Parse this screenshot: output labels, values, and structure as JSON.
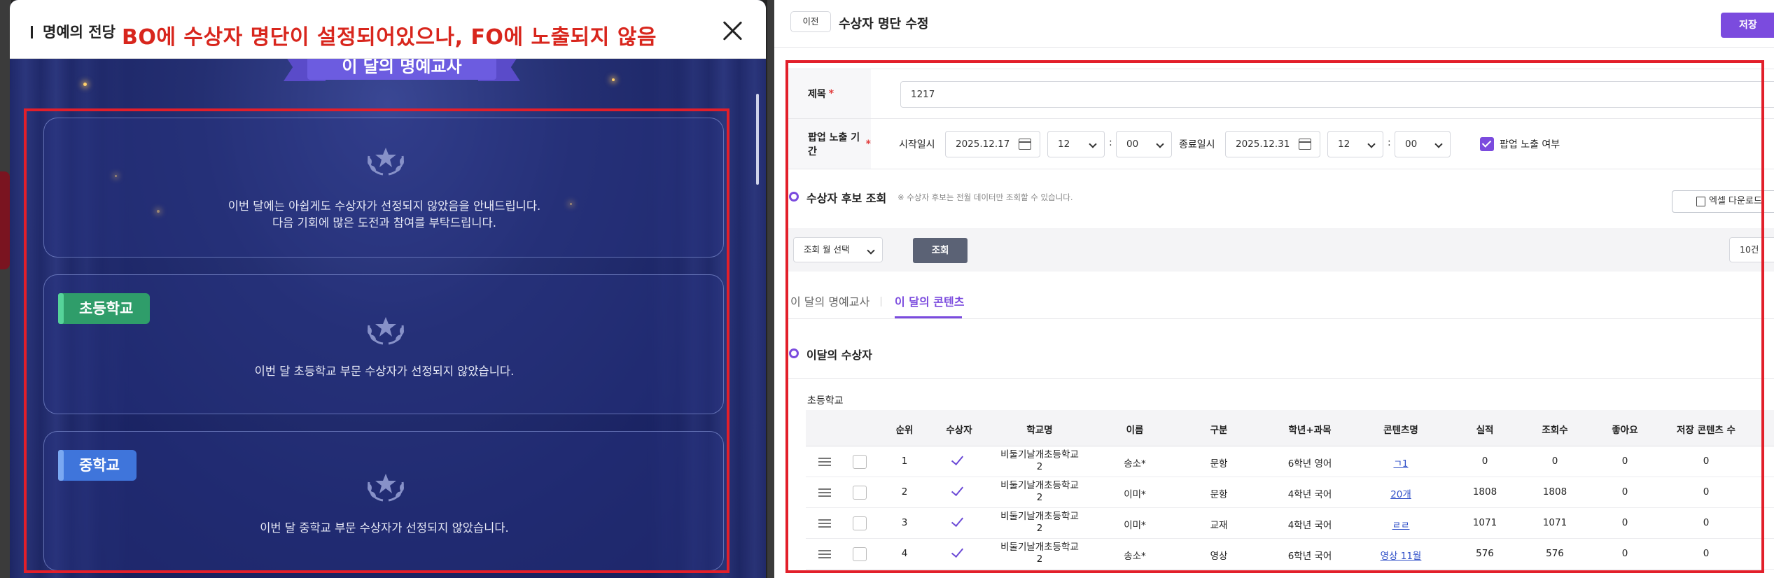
{
  "left": {
    "modal_title": "명예의 전당",
    "issue_note": "BO에 수상자 명단이 설정되어있으나, FO에 노출되지 않음",
    "ribbon_text": "이 달의 명예교사",
    "notice_line1": "이번 달에는 아쉽게도 수상자가 선정되지 않았음을 안내드립니다.",
    "notice_line2": "다음 기회에 많은 도전과 참여를 부탁드립니다.",
    "elementary": {
      "badge": "초등학교",
      "message": "이번 달 초등학교 부문 수상자가 선정되지 않았습니다."
    },
    "middle": {
      "badge": "중학교",
      "message": "이번 달 중학교 부문 수상자가 선정되지 않았습니다."
    }
  },
  "right": {
    "prev_label": "이전",
    "page_title": "수상자 명단 수정",
    "save_label": "저장",
    "form": {
      "title_label": "제목",
      "title_value": "1217",
      "period_label": "팝업 노출 기간",
      "start_label": "시작일시",
      "start_date": "2025.12.17",
      "start_hour": "12",
      "start_min": "00",
      "end_label": "종료일시",
      "end_date": "2025.12.31",
      "end_hour": "12",
      "end_min": "00",
      "popup_label": "팝업 노출 여부",
      "colon": ":",
      "required_mark": "*"
    },
    "candidates": {
      "title": "수상자 후보 조회",
      "hint": "※ 수상자 후보는 전월 데이터만 조회할 수 있습니다.",
      "excel_label": "엑셀 다운로드",
      "month_select": "조회 월 선택",
      "search_label": "조회",
      "page_size": "10건"
    },
    "tabs": [
      "이 달의 명예교사",
      "이 달의 콘텐츠"
    ],
    "winners_title": "이달의 수상자",
    "group_label": "초등학교",
    "columns": [
      "순위",
      "수상자",
      "학교명",
      "이름",
      "구분",
      "학년+과목",
      "콘텐츠명",
      "실적",
      "조회수",
      "좋아요",
      "저장 콘텐츠 수"
    ],
    "rows": [
      {
        "rank": "1",
        "school": "비둘기날개초등학교2",
        "name": "송소*",
        "type": "문항",
        "grade": "6학년 영어",
        "content": "ㄱ1",
        "perf": "0",
        "views": "0",
        "likes": "0",
        "saved": "0"
      },
      {
        "rank": "2",
        "school": "비둘기날개초등학교2",
        "name": "이미*",
        "type": "문항",
        "grade": "4학년 국어",
        "content": "20개",
        "perf": "1808",
        "views": "1808",
        "likes": "0",
        "saved": "0"
      },
      {
        "rank": "3",
        "school": "비둘기날개초등학교2",
        "name": "이미*",
        "type": "교재",
        "grade": "4학년 국어",
        "content": "ㄹㄹ",
        "perf": "1071",
        "views": "1071",
        "likes": "0",
        "saved": "0"
      },
      {
        "rank": "4",
        "school": "비둘기날개초등학교2",
        "name": "송소*",
        "type": "영상",
        "grade": "6학년 국어",
        "content": "영상 11월",
        "perf": "576",
        "views": "576",
        "likes": "0",
        "saved": "0"
      }
    ]
  },
  "colors": {
    "accent": "#7b4bde",
    "annotation": "#e21f2a",
    "modal_bg": "#1a2363"
  }
}
